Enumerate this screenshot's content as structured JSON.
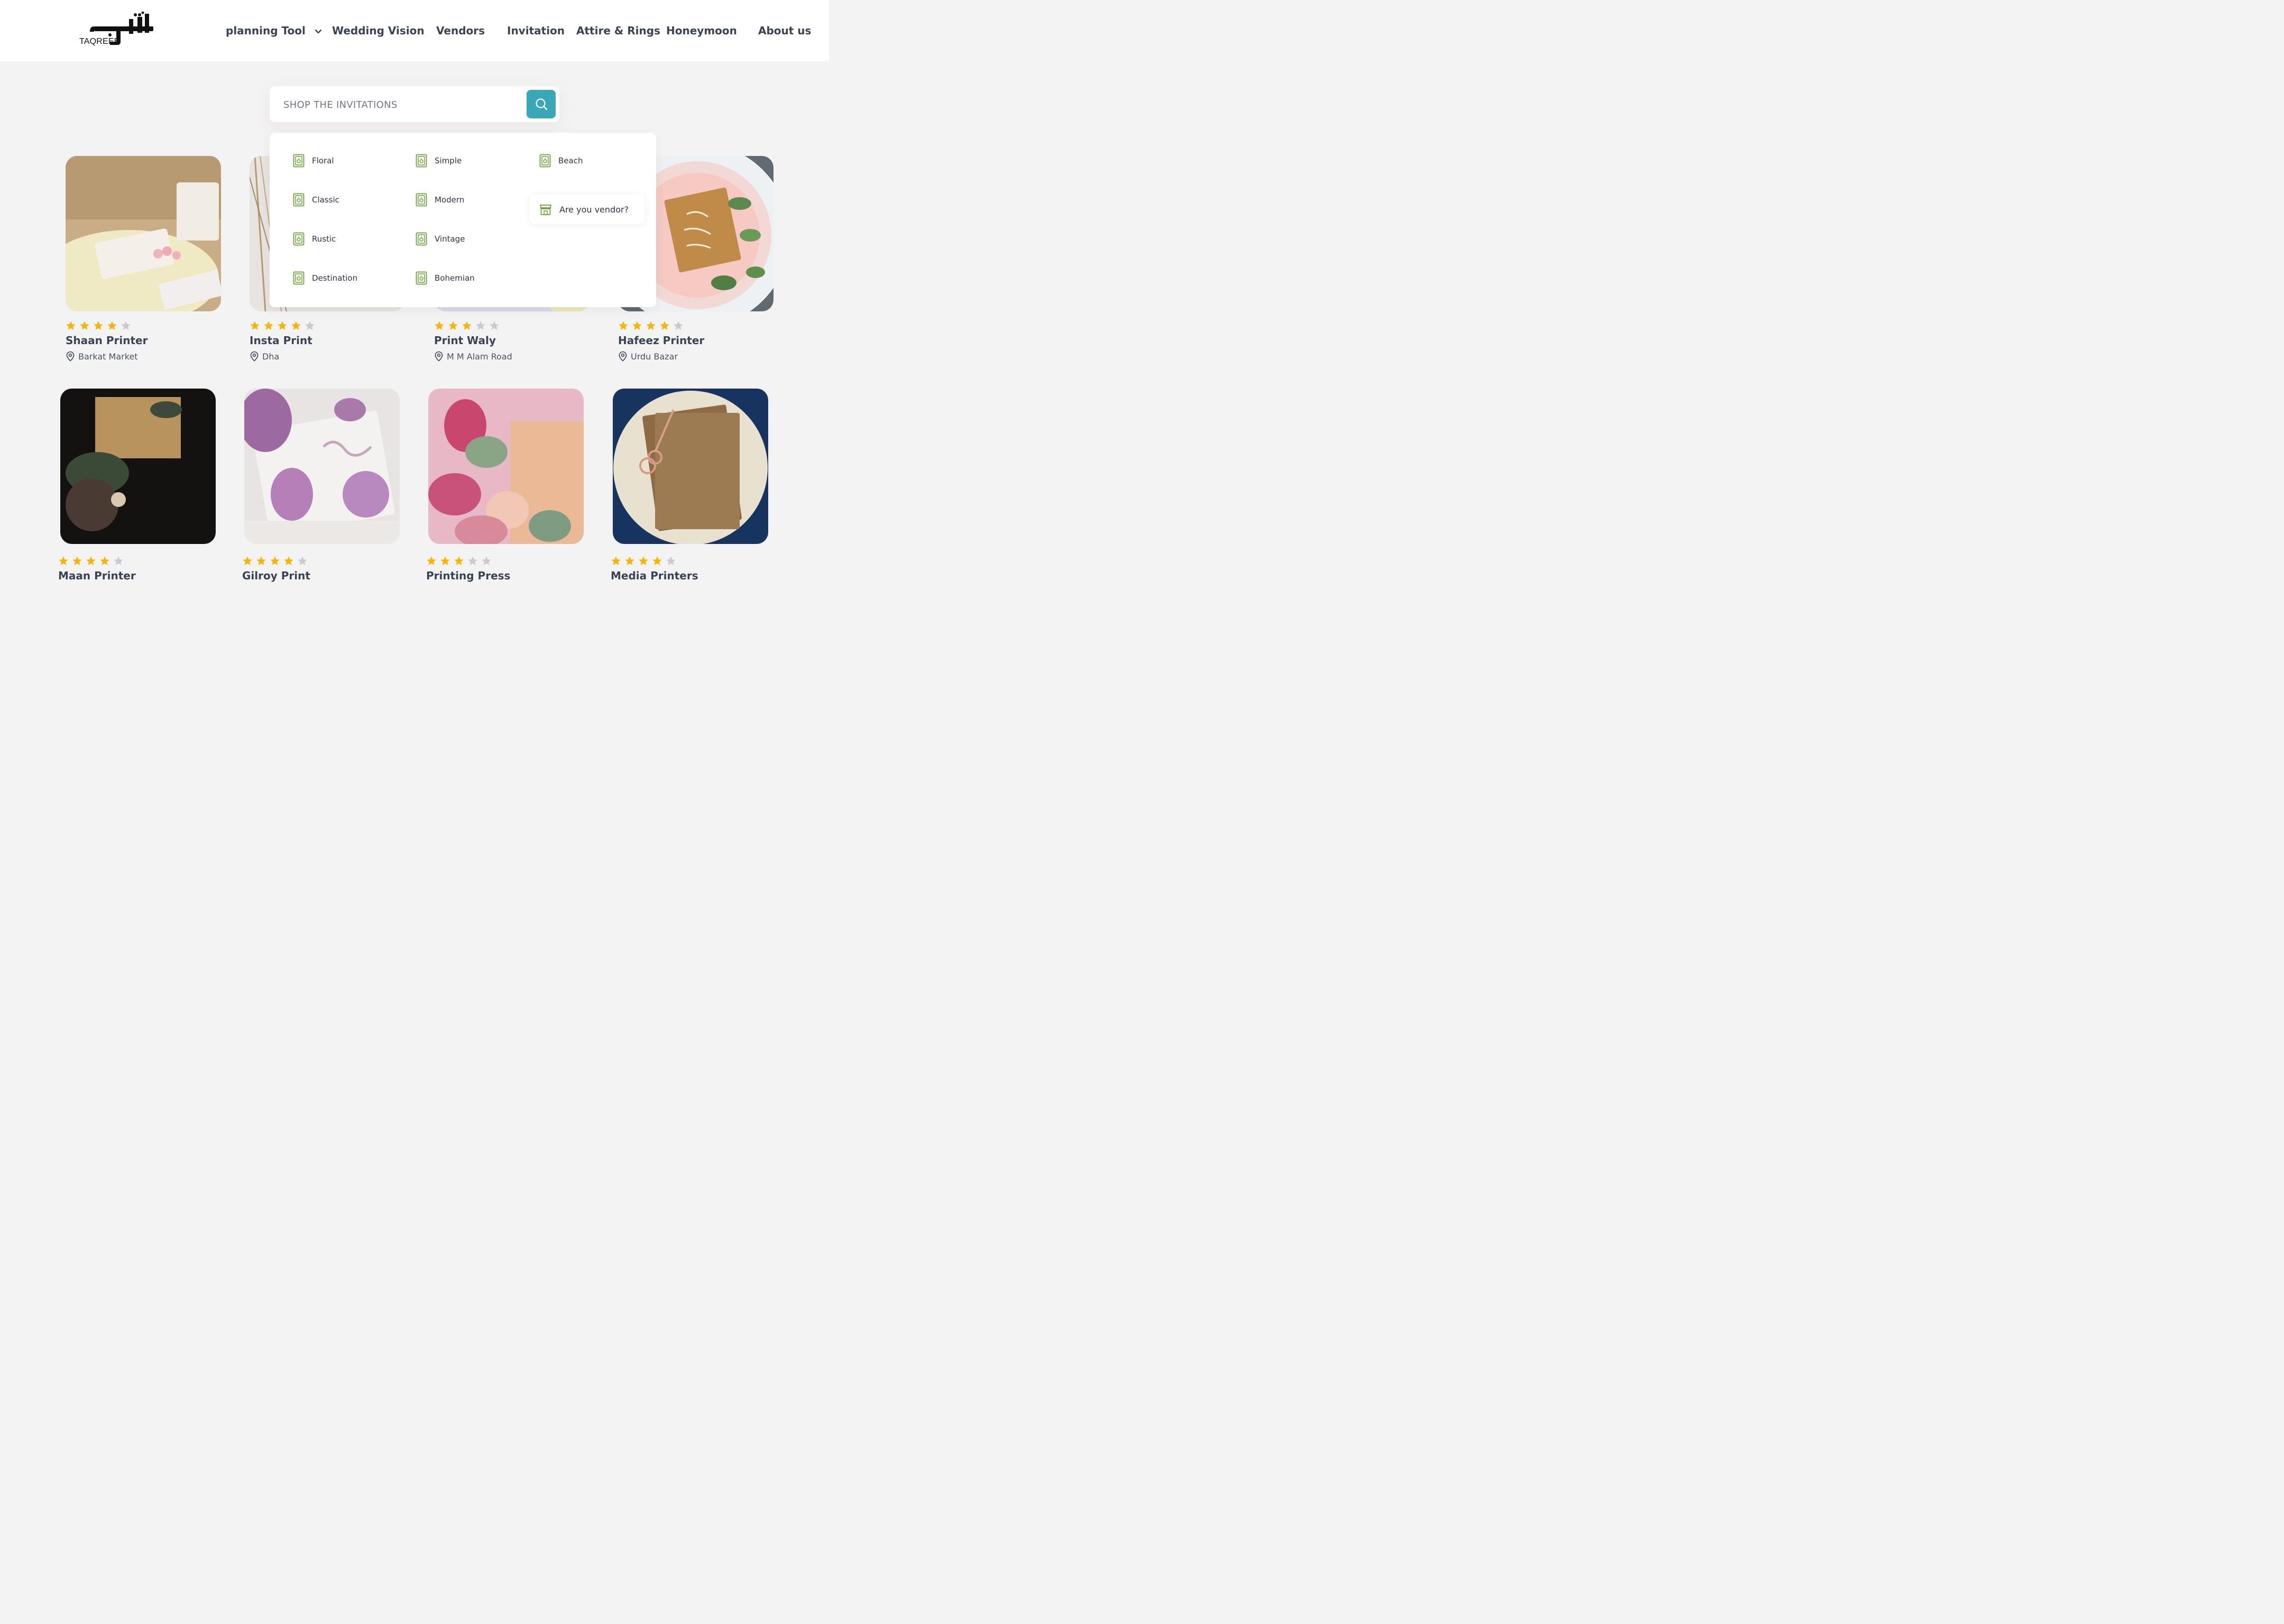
{
  "brand": {
    "logo_text": "TAQREEB"
  },
  "nav": {
    "items": [
      {
        "label": "planning Tool",
        "has_dropdown": true
      },
      {
        "label": "Wedding Vision"
      },
      {
        "label": "Vendors"
      },
      {
        "label": "Invitation"
      },
      {
        "label": "Attire & Rings"
      },
      {
        "label": "Honeymoon"
      },
      {
        "label": "About us"
      }
    ]
  },
  "search": {
    "placeholder": "SHOP THE INVITATIONS",
    "icon": "search-icon"
  },
  "dropdown": {
    "categories": [
      {
        "label": "Floral"
      },
      {
        "label": "Simple"
      },
      {
        "label": "Beach"
      },
      {
        "label": "Classic"
      },
      {
        "label": "Modern"
      },
      {
        "label": "Rustic"
      },
      {
        "label": "Vintage"
      },
      {
        "label": "Destination"
      },
      {
        "label": "Bohemian"
      }
    ],
    "vendor_cta": "Are you vendor?"
  },
  "vendors": [
    {
      "name": "Shaan Printer",
      "location": "Barkat Market",
      "rating": 4
    },
    {
      "name": "Insta Print",
      "location": "Dha",
      "rating": 4
    },
    {
      "name": "Print Waly",
      "location": "M M Alam Road",
      "rating": 3
    },
    {
      "name": "Hafeez Printer",
      "location": "Urdu Bazar",
      "rating": 4
    },
    {
      "name": "Maan Printer",
      "location": "",
      "rating": 4
    },
    {
      "name": "Gilroy Print",
      "location": "",
      "rating": 4
    },
    {
      "name": "Printing Press",
      "location": "",
      "rating": 3
    },
    {
      "name": "Media Printers",
      "location": "",
      "rating": 4
    }
  ],
  "colors": {
    "accent": "#3aa7b9",
    "star_filled": "#f5b50a",
    "star_empty": "#c9cbd0",
    "icon_green": "#6aa233",
    "text_dark": "#3b4256"
  }
}
